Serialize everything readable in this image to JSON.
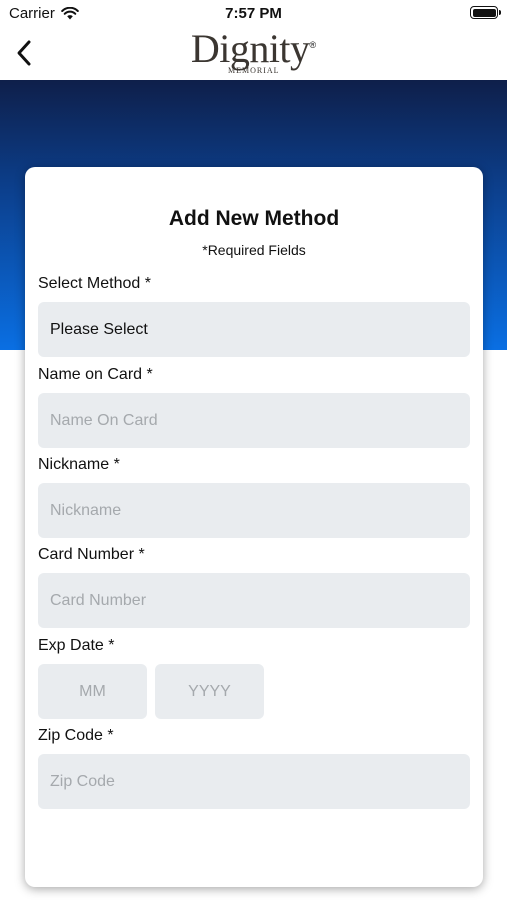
{
  "status_bar": {
    "carrier": "Carrier",
    "time": "7:57 PM"
  },
  "nav": {
    "logo_text": "Dignity",
    "logo_sub": "MEMORIAL",
    "logo_reg": "®"
  },
  "form": {
    "title": "Add New Method",
    "required_note": "*Required Fields",
    "select_method": {
      "label": "Select Method *",
      "value": "Please Select"
    },
    "name_on_card": {
      "label": "Name on Card *",
      "placeholder": "Name On Card"
    },
    "nickname": {
      "label": "Nickname *",
      "placeholder": "Nickname"
    },
    "card_number": {
      "label": "Card Number *",
      "placeholder": "Card Number"
    },
    "exp_date": {
      "label": "Exp Date *",
      "month_placeholder": "MM",
      "year_placeholder": "YYYY"
    },
    "zip_code": {
      "label": "Zip Code *",
      "placeholder": "Zip Code"
    }
  },
  "colors": {
    "hero_top": "#0e1f4a",
    "hero_bottom": "#0a6fe3",
    "field_bg": "#e9ecef"
  }
}
